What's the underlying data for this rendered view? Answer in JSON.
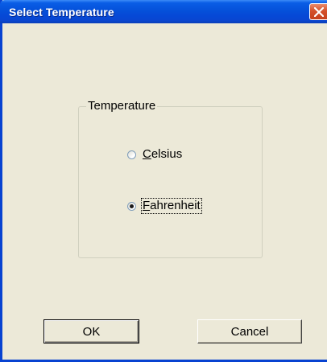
{
  "window": {
    "title": "Select Temperature",
    "close_icon": "close-icon"
  },
  "group": {
    "label": "Temperature"
  },
  "options": [
    {
      "mnemonic": "C",
      "rest": "elsius",
      "label": "Celsius",
      "selected": false
    },
    {
      "mnemonic": "F",
      "rest": "ahrenheit",
      "label": "Fahrenheit",
      "selected": true
    }
  ],
  "buttons": {
    "ok_label": "OK",
    "cancel_label": "Cancel"
  },
  "colors": {
    "titlebar": "#0551da",
    "dialog_bg": "#ece9d8",
    "close_button": "#d4502a"
  }
}
